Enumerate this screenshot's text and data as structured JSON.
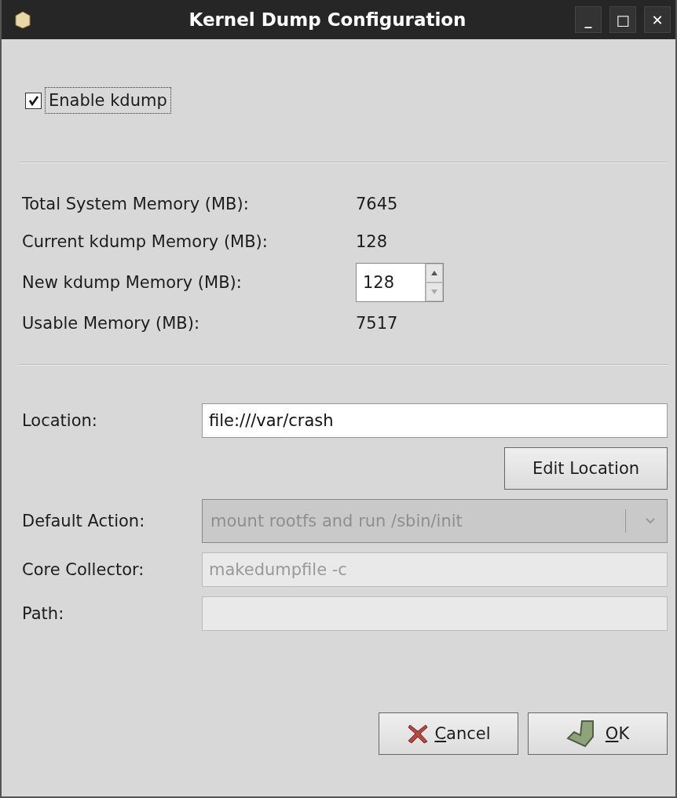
{
  "window": {
    "title": "Kernel Dump Configuration",
    "controls": [
      "_",
      "□",
      "✕"
    ]
  },
  "enable_checkbox": {
    "label": "Enable kdump",
    "checked": true
  },
  "memory": [
    {
      "label": "Total System Memory (MB):",
      "value": "7645",
      "kind": "text"
    },
    {
      "label": "Current kdump Memory (MB):",
      "value": "128",
      "kind": "text"
    },
    {
      "label": "New kdump Memory (MB):",
      "value": "128",
      "kind": "spin"
    },
    {
      "label": "Usable Memory (MB):",
      "value": "7517",
      "kind": "text"
    }
  ],
  "location": {
    "label": "Location:",
    "value": "file:///var/crash",
    "button": "Edit Location"
  },
  "settings": [
    {
      "label": "Default Action:",
      "value": "mount rootfs and run /sbin/init",
      "kind": "combo",
      "disabled": true
    },
    {
      "label": "Core Collector:",
      "value": "makedumpfile -c",
      "kind": "field",
      "disabled": true
    },
    {
      "label": "Path:",
      "kind": "field",
      "disabled": true
    }
  ],
  "buttons": [
    {
      "label": "Cancel",
      "first_letter_underlined": true,
      "kind": "cancel"
    },
    {
      "label": "OK",
      "first_letter_underlined": true,
      "kind": "ok"
    }
  ]
}
